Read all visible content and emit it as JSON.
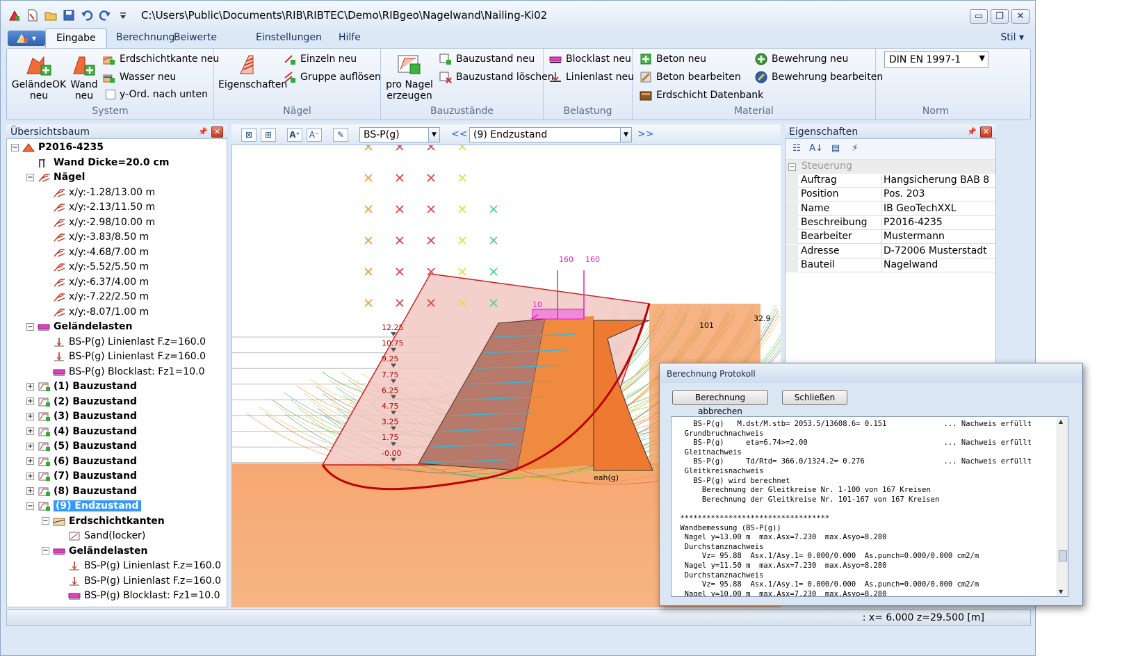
{
  "window": {
    "title": "C:\\Users\\Public\\Documents\\RIB\\RIBTEC\\Demo\\RIBgeo\\Nagelwand\\Nailing-Ki02",
    "controls": [
      "▭",
      "❐",
      "✕"
    ]
  },
  "quick_access": [
    "new-file-icon",
    "open-file-icon",
    "folder-icon",
    "save-icon",
    "undo-icon",
    "redo-icon",
    "customize-icon"
  ],
  "tabs": [
    "Eingabe",
    "Berechnung",
    "Beiwerte",
    "Einstellungen",
    "Hilfe"
  ],
  "active_tab": "Eingabe",
  "stil_label": "Stil",
  "ribbon": {
    "system": {
      "label": "System",
      "gelaende_ok": "GeländeOK\nneu",
      "gelaende_ok_l1": "GeländeOK",
      "gelaende_ok_l2": "neu",
      "wand_l1": "Wand",
      "wand_l2": "neu",
      "erdschichtkante": "Erdschichtkante neu",
      "wasser": "Wasser neu",
      "y_ord": "y-Ord. nach unten"
    },
    "naegel": {
      "label": "Nägel",
      "eigenschaften": "Eigenschaften",
      "einzeln": "Einzeln neu",
      "gruppe": "Gruppe auflösen"
    },
    "bauzustaende": {
      "label": "Bauzustände",
      "pro_nagel_l1": "pro Nagel",
      "pro_nagel_l2": "erzeugen",
      "neu": "Bauzustand neu",
      "loeschen": "Bauzustand löschen"
    },
    "belastung": {
      "label": "Belastung",
      "blocklast": "Blocklast neu",
      "linienlast": "Linienlast neu"
    },
    "material": {
      "label": "Material",
      "beton_neu": "Beton neu",
      "beton_bearbeiten": "Beton bearbeiten",
      "erdschicht_db": "Erdschicht Datenbank",
      "bewehrung_neu": "Bewehrung neu",
      "bewehrung_bearbeiten": "Bewehrung bearbeiten"
    },
    "norm": {
      "label": "Norm",
      "selected": "DIN EN 1997-1"
    }
  },
  "tree_panel": {
    "title": "Übersichtsbaum",
    "nodes": [
      {
        "label": "P2016-4235",
        "bold": true
      },
      {
        "label": "Wand Dicke=20.0 cm",
        "bold": true
      },
      {
        "label": "Nägel",
        "bold": true
      },
      {
        "label": "x/y:-1.28/13.00 m"
      },
      {
        "label": "x/y:-2.13/11.50 m"
      },
      {
        "label": "x/y:-2.98/10.00 m"
      },
      {
        "label": "x/y:-3.83/8.50 m"
      },
      {
        "label": "x/y:-4.68/7.00 m"
      },
      {
        "label": "x/y:-5.52/5.50 m"
      },
      {
        "label": "x/y:-6.37/4.00 m"
      },
      {
        "label": "x/y:-7.22/2.50 m"
      },
      {
        "label": "x/y:-8.07/1.00 m"
      },
      {
        "label": "Geländelasten",
        "bold": true
      },
      {
        "label": "BS-P(g) Linienlast F.z=160.0"
      },
      {
        "label": "BS-P(g) Linienlast F.z=160.0"
      },
      {
        "label": "BS-P(g) Blocklast: Fz1=10.0"
      },
      {
        "label": "(1) Bauzustand",
        "bold": true
      },
      {
        "label": "(2) Bauzustand",
        "bold": true
      },
      {
        "label": "(3) Bauzustand",
        "bold": true
      },
      {
        "label": "(4) Bauzustand",
        "bold": true
      },
      {
        "label": "(5) Bauzustand",
        "bold": true
      },
      {
        "label": "(6) Bauzustand",
        "bold": true
      },
      {
        "label": "(7) Bauzustand",
        "bold": true
      },
      {
        "label": "(8) Bauzustand",
        "bold": true
      },
      {
        "label": "(9) Endzustand",
        "bold": true,
        "selected": true
      },
      {
        "label": "Erdschichtkanten",
        "bold": true
      },
      {
        "label": "Sand(locker)"
      },
      {
        "label": "Geländelasten",
        "bold": true
      },
      {
        "label": "BS-P(g) Linienlast F.z=160.0"
      },
      {
        "label": "BS-P(g) Linienlast F.z=160.0"
      },
      {
        "label": "BS-P(g) Blocklast: Fz1=10.0"
      }
    ]
  },
  "viewport": {
    "load_case": "BS-P(g)",
    "state": "(9) Endzustand",
    "prev": "<<",
    "next": ">>",
    "depth_labels": [
      "12.25",
      "10.75",
      "9.25",
      "7.75",
      "6.25",
      "4.75",
      "3.25",
      "1.75",
      "-0.00"
    ],
    "load_labels": [
      "160",
      "160",
      "10"
    ],
    "value_labels": [
      "101",
      "32.9"
    ],
    "eah_label": "eah(g)"
  },
  "properties": {
    "title": "Eigenschaften",
    "category": "Steuerung",
    "rows": [
      {
        "key": "Auftrag",
        "value": "Hangsicherung BAB 8"
      },
      {
        "key": "Position",
        "value": "Pos. 203"
      },
      {
        "key": "Name",
        "value": "IB GeoTechXXL"
      },
      {
        "key": "Beschreibung",
        "value": "P2016-4235"
      },
      {
        "key": "Bearbeiter",
        "value": "Mustermann"
      },
      {
        "key": "Adresse",
        "value": "D-72006 Musterstadt"
      },
      {
        "key": "Bauteil",
        "value": "Nagelwand"
      }
    ]
  },
  "status": {
    "coords": ":   x= 6.000   z=29.500 [m]"
  },
  "dialog": {
    "title": "Berechnung Protokoll",
    "cancel_button": "Berechnung abbrechen",
    "close_button": "Schließen",
    "log": [
      "    BS-P(g)   M.dst/M.stb= 2053.5/13608.6= 0.151             ... Nachweis erfüllt",
      "  Grundbruchnachweis",
      "    BS-P(g)     eta=6.74>=2.00                               ... Nachweis erfüllt",
      "  Gleitnachweis",
      "    BS-P(g)     Td/Rtd= 366.0/1324.2= 0.276                  ... Nachweis erfüllt",
      "  Gleitkreisnachweis",
      "    BS-P(g) wird berechnet",
      "      Berechnung der Gleitkreise Nr. 1-100 von 167 Kreisen",
      "      Berechnung der Gleitkreise Nr. 101-167 von 167 Kreisen",
      "",
      " **********************************",
      " Wandbemessung (BS-P(g))",
      "  Nagel y=13.00 m  max.Asx=7.230  max.Asyo=8.280",
      "  Durchstanznachweis",
      "      Vz= 95.88  Asx.1/Asy.1= 0.000/0.000  As.punch=0.000/0.000 cm2/m",
      "  Nagel y=11.50 m  max.Asx=7.230  max.Asyo=8.280",
      "  Durchstanznachweis",
      "      Vz= 95.88  Asx.1/Asy.1= 0.000/0.000  As.punch=0.000/0.000 cm2/m",
      "  Nagel y=10.00 m  max.Asx=7.230  max.Asyo=8.280"
    ]
  },
  "colors": {
    "ribbon_bg": "#dfe9f6",
    "selection": "#3399ff",
    "soil_orange": "#f4a070",
    "wall_red": "#c00000",
    "load_magenta": "#e020c0"
  }
}
